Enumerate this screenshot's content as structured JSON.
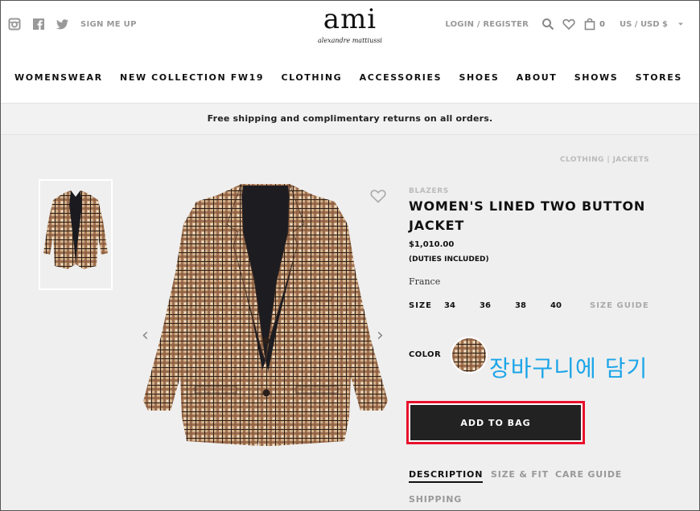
{
  "header": {
    "signup_label": "SIGN ME UP",
    "logo_text": "ami",
    "logo_sub": "alexandre mattiussi",
    "login_label": "LOGIN / REGISTER",
    "bag_count": "0",
    "currency": "US / USD $"
  },
  "nav": [
    "WOMENSWEAR",
    "NEW COLLECTION FW19",
    "CLOTHING",
    "ACCESSORIES",
    "SHOES",
    "ABOUT",
    "SHOWS",
    "STORES"
  ],
  "banner": "Free shipping and  complimentary returns on all orders.",
  "breadcrumb": "CLOTHING  |  JACKETS",
  "product": {
    "category": "BLAZERS",
    "title_line1": "WOMEN'S LINED TWO BUTTON",
    "title_line2": "JACKET",
    "price": "$1,010.00",
    "duties": "(DUTIES INCLUDED)",
    "origin": "France",
    "size_label": "SIZE",
    "sizes": [
      "34",
      "36",
      "38",
      "40"
    ],
    "size_guide": "SIZE GUIDE",
    "color_label": "COLOR",
    "add_to_bag": "ADD TO BAG"
  },
  "annotation": "장바구니에 담기",
  "tabs": [
    "DESCRIPTION",
    "SIZE & FIT",
    "CARE GUIDE",
    "SHIPPING"
  ],
  "colors": {
    "accent_red": "#e8102c",
    "annotation_blue": "#1aa5e8",
    "button": "#222222"
  }
}
